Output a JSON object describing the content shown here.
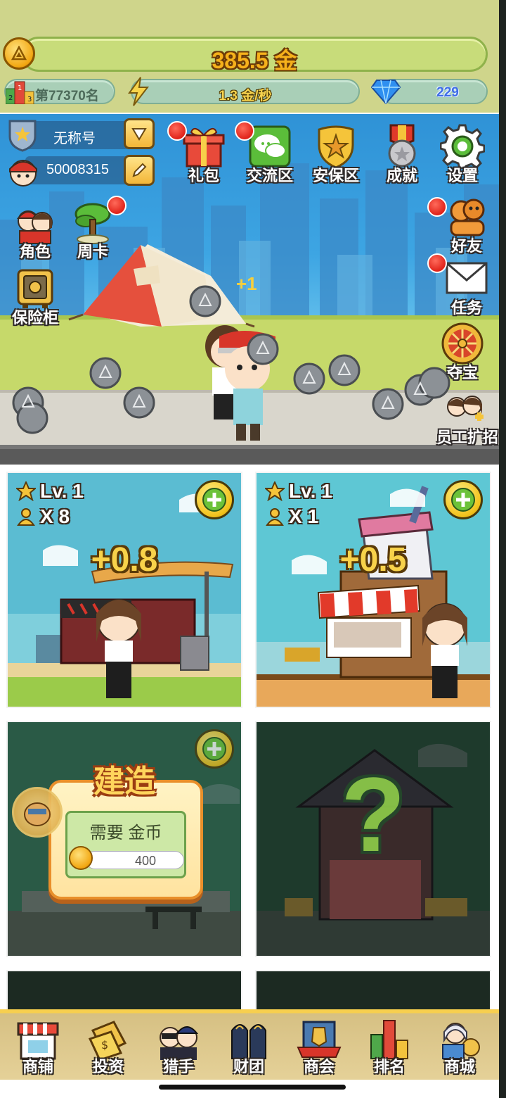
{
  "header": {
    "gold_total": "385.5 金",
    "rank": "第77370名",
    "gold_rate": "1.3 金/秒",
    "gems": "229"
  },
  "profile": {
    "name": "无称号",
    "player_id": "50008315"
  },
  "top_menu": [
    {
      "label": "礼包",
      "icon": "gift-icon",
      "badge": true
    },
    {
      "label": "交流区",
      "icon": "chat-icon",
      "badge": true
    },
    {
      "label": "安保区",
      "icon": "shield-icon",
      "badge": false
    },
    {
      "label": "成就",
      "icon": "medal-icon",
      "badge": false
    },
    {
      "label": "设置",
      "icon": "gear-icon",
      "badge": false
    }
  ],
  "left_menu": [
    {
      "label": "角色",
      "icon": "characters-icon",
      "badge": false
    },
    {
      "label": "周卡",
      "icon": "tree-icon",
      "badge": true
    },
    {
      "label": "保险柜",
      "icon": "safe-icon",
      "badge": false
    }
  ],
  "right_menu": [
    {
      "label": "好友",
      "icon": "friends-icon",
      "badge": true
    },
    {
      "label": "任务",
      "icon": "mail-icon",
      "badge": true
    },
    {
      "label": "夺宝",
      "icon": "wheel-icon",
      "badge": false
    },
    {
      "label": "员工扩招",
      "icon": "hire-icon",
      "badge": false
    }
  ],
  "scene": {
    "floating_gain": "+1"
  },
  "buildings": [
    {
      "level": "Lv. 1",
      "staff": "X 8",
      "income": "+0.8"
    },
    {
      "level": "Lv. 1",
      "staff": "X 1",
      "income": "+0.5"
    }
  ],
  "build_card": {
    "title": "建造",
    "requirement": "需要 金币",
    "cost": "400"
  },
  "locked_card": {
    "symbol": "?"
  },
  "bottom_nav": [
    {
      "label": "商铺",
      "icon": "shop-icon"
    },
    {
      "label": "投资",
      "icon": "invest-icon"
    },
    {
      "label": "猎手",
      "icon": "hunter-icon"
    },
    {
      "label": "财团",
      "icon": "consortium-icon"
    },
    {
      "label": "商会",
      "icon": "chamber-icon"
    },
    {
      "label": "排名",
      "icon": "ranking-icon"
    },
    {
      "label": "商城",
      "icon": "mall-icon"
    }
  ],
  "colors": {
    "header_bg": "#cfd58b",
    "gold_text": "#f6b11b",
    "badge_red": "#e0231a",
    "nav_bg": "#e5d198"
  }
}
